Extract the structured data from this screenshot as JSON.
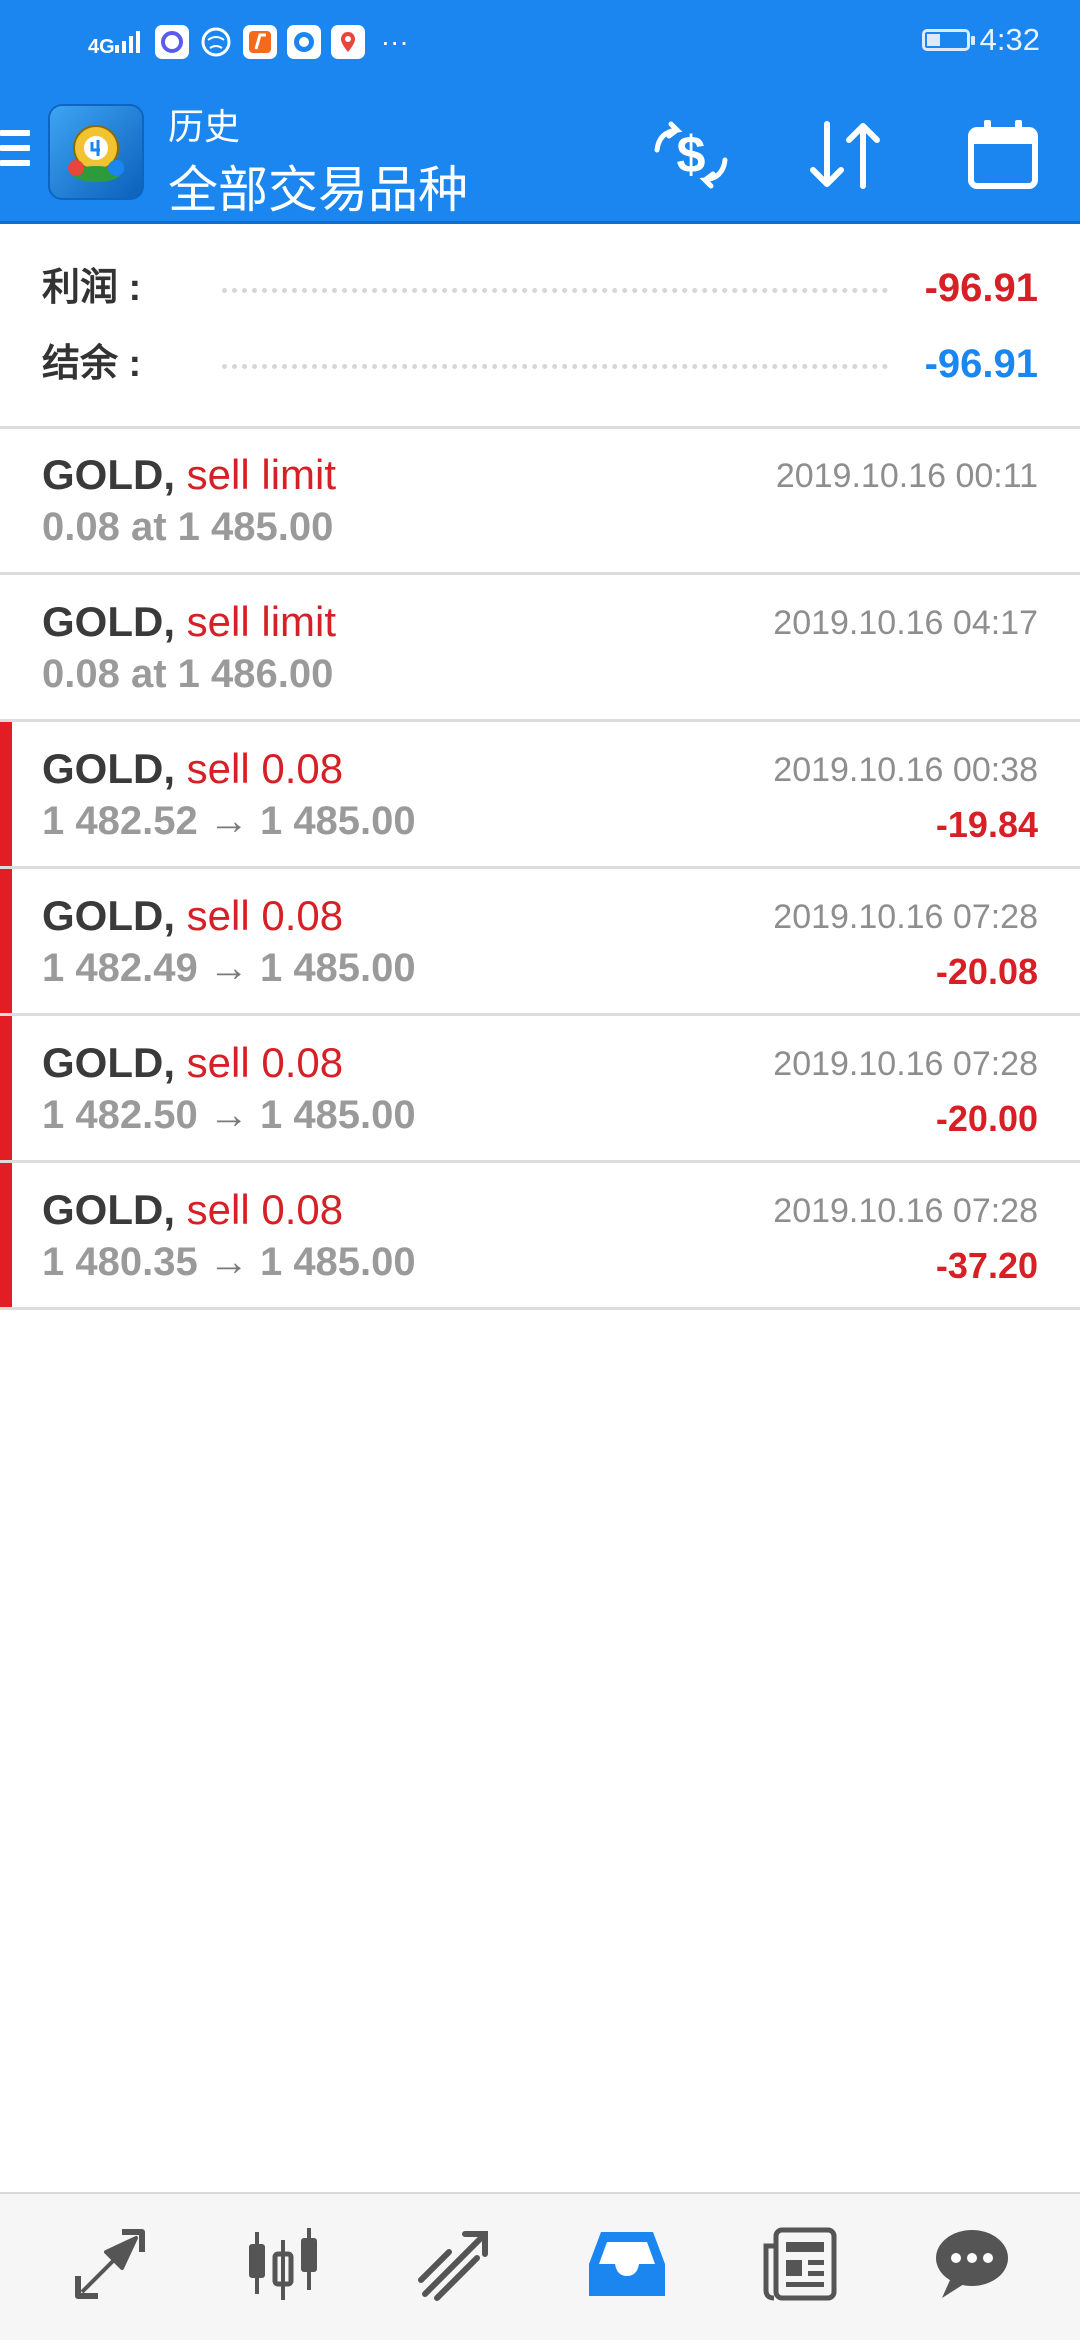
{
  "status_bar": {
    "signal": "4G",
    "time": "4:32",
    "battery_level": 0.35,
    "app_icons": [
      "q-app-icon",
      "globe-app-icon",
      "f-app-icon",
      "browser-app-icon",
      "map-pin-app-icon"
    ],
    "overflow": "···"
  },
  "header": {
    "subtitle": "历史",
    "title": "全部交易品种",
    "actions": [
      "currency-exchange-icon",
      "sort-icon",
      "calendar-icon"
    ]
  },
  "summary": {
    "profit_label": "利润 :",
    "profit_value": "-96.91",
    "balance_label": "结余 :",
    "balance_value": "-96.91"
  },
  "trades": [
    {
      "symbol": "GOLD,",
      "type": "sell limit",
      "detail": "0.08 at 1 485.00",
      "date": "2019.10.16 00:11",
      "pnl": ""
    },
    {
      "symbol": "GOLD,",
      "type": "sell limit",
      "detail": "0.08 at 1 486.00",
      "date": "2019.10.16 04:17",
      "pnl": ""
    },
    {
      "symbol": "GOLD,",
      "type": "sell 0.08",
      "open": "1 482.52",
      "arrow": "→",
      "close": "1 485.00",
      "date": "2019.10.16 00:38",
      "pnl": "-19.84"
    },
    {
      "symbol": "GOLD,",
      "type": "sell 0.08",
      "open": "1 482.49",
      "arrow": "→",
      "close": "1 485.00",
      "date": "2019.10.16 07:28",
      "pnl": "-20.08"
    },
    {
      "symbol": "GOLD,",
      "type": "sell 0.08",
      "open": "1 482.50",
      "arrow": "→",
      "close": "1 485.00",
      "date": "2019.10.16 07:28",
      "pnl": "-20.00"
    },
    {
      "symbol": "GOLD,",
      "type": "sell 0.08",
      "open": "1 480.35",
      "arrow": "→",
      "close": "1 485.00",
      "date": "2019.10.16 07:28",
      "pnl": "-37.20"
    }
  ],
  "bottom_nav": {
    "items": [
      "quotes-icon",
      "chart-icon",
      "trade-icon",
      "history-icon",
      "news-icon",
      "chat-icon"
    ],
    "active": "history-icon"
  },
  "colors": {
    "primary": "#1b86f0",
    "negative": "#d71f26",
    "loss_bar": "#e31d24",
    "balance": "#1b86f0"
  }
}
